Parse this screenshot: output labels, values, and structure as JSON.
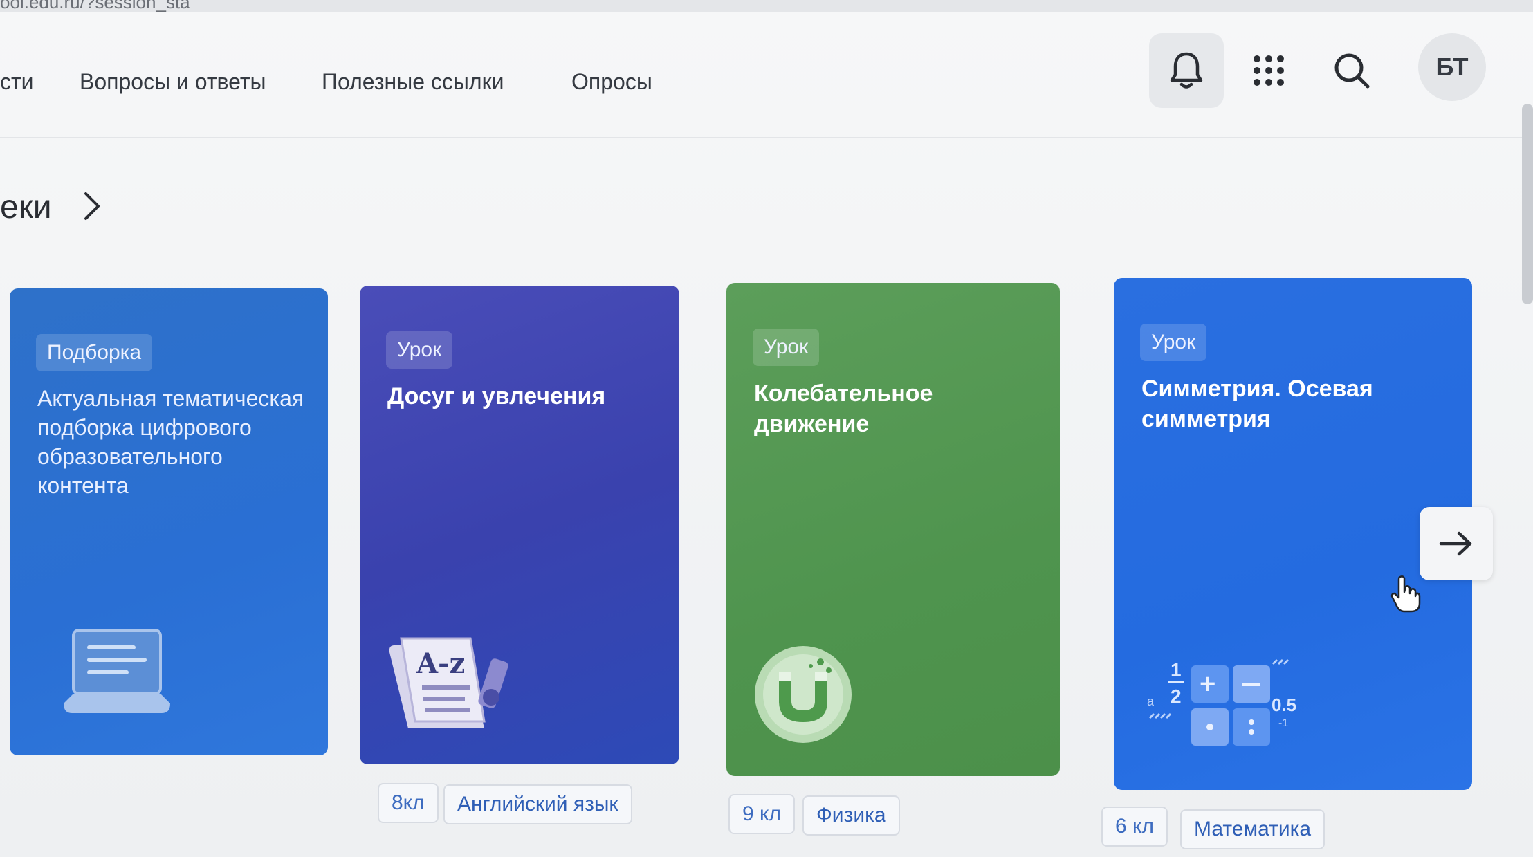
{
  "browser": {
    "url_fragment": "ool.edu.ru/?session_sta"
  },
  "nav": {
    "items": [
      {
        "label": "сти"
      },
      {
        "label": "Вопросы и ответы"
      },
      {
        "label": "Полезные ссылки"
      },
      {
        "label": "Опросы"
      }
    ]
  },
  "header": {
    "avatar_initials": "БТ",
    "icons": [
      "bell-icon",
      "apps-grid-icon",
      "search-icon"
    ]
  },
  "section": {
    "title": "еки"
  },
  "cards": [
    {
      "badge": "Подборка",
      "title": "Актуальная тематическая подборка цифрового образовательного контента",
      "icon": "laptop-icon",
      "color": "#2e71c9"
    },
    {
      "badge": "Урок",
      "title": "Досуг и увлечения",
      "icon": "dictionary-az-icon",
      "color": "#3e45b0",
      "tags": [
        "8кл",
        "Английский язык"
      ]
    },
    {
      "badge": "Урок",
      "title": "Колебательное движение",
      "icon": "magnet-icon",
      "color": "#579a55",
      "tags": [
        "9 кл",
        "Физика"
      ]
    },
    {
      "badge": "Урок",
      "title": "Симметрия. Осевая симметрия",
      "icon": "math-symbols-icon",
      "color": "#276ee2",
      "tags": [
        "6 кл",
        "Математика"
      ],
      "illus_text": {
        "half_num": "1",
        "half_den": "2",
        "decimal": "0.5",
        "neg": "-1",
        "var": "a"
      }
    }
  ]
}
